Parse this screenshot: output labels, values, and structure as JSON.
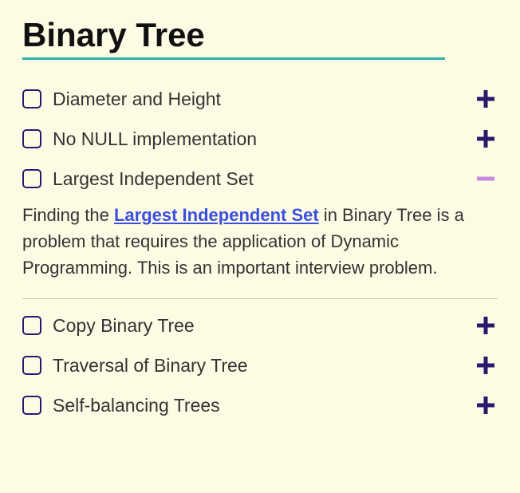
{
  "heading": "Binary Tree",
  "items": [
    {
      "label": "Diameter and Height",
      "expanded": false
    },
    {
      "label": "No NULL implementation",
      "expanded": false
    },
    {
      "label": "Largest Independent Set",
      "expanded": true
    },
    {
      "label": "Copy Binary Tree",
      "expanded": false
    },
    {
      "label": "Traversal of Binary Tree",
      "expanded": false
    },
    {
      "label": "Self-balancing Trees",
      "expanded": false
    }
  ],
  "expanded_detail": {
    "prefix": "Finding the ",
    "link": "Largest Independent Set",
    "suffix": " in Binary Tree is a problem that requires the application of Dynamic Programming. This is an important interview problem."
  }
}
